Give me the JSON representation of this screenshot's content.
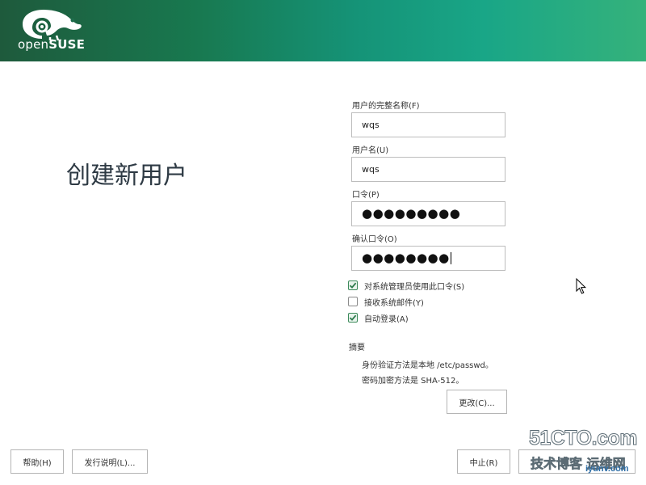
{
  "header": {
    "brand_prefix": "open",
    "brand_name": "SUSE",
    "accent_color": "#159377"
  },
  "page_title": "创建新用户",
  "form": {
    "full_name": {
      "label": "用户的完整名称(F)",
      "value": "wqs"
    },
    "username": {
      "label": "用户名(U)",
      "value": "wqs"
    },
    "password": {
      "label": "口令(P)",
      "value": "●●●●●●●●●"
    },
    "confirm_password": {
      "label": "确认口令(O)",
      "value": "●●●●●●●●"
    }
  },
  "options": [
    {
      "label": "对系统管理员使用此口令(S)",
      "checked": true
    },
    {
      "label": "接收系统邮件(Y)",
      "checked": false
    },
    {
      "label": "自动登录(A)",
      "checked": true
    }
  ],
  "summary": {
    "title": "摘要",
    "lines": [
      "身份验证方法是本地 /etc/passwd。",
      "密码加密方法是 SHA-512。"
    ],
    "change_button": "更改(C)..."
  },
  "buttons": {
    "help": "帮助(H)",
    "release_notes": "发行说明(L)...",
    "abort": "中止(R)"
  },
  "watermark": {
    "line1": "51CTO.com",
    "line2": "技术博客 运维网",
    "site": "iyunv.com"
  }
}
